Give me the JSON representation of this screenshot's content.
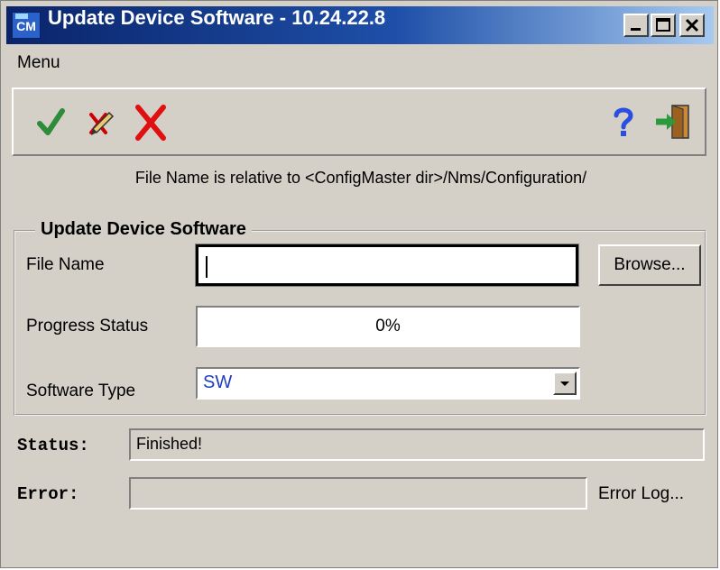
{
  "window": {
    "title": "Update Device Software - 10.24.22.8",
    "app_icon_text": "CM",
    "title_buttons": [
      "minimize-icon",
      "maximize-icon",
      "close-icon"
    ]
  },
  "menu": {
    "items": [
      "Menu"
    ]
  },
  "toolbar": {
    "tools": [
      {
        "name": "apply",
        "icon": "checkmark-icon",
        "color": "#2e8b3a"
      },
      {
        "name": "edit",
        "icon": "pencil-cross-icon",
        "color": "#cc0000"
      },
      {
        "name": "cancel",
        "icon": "red-x-icon",
        "color": "#e01010"
      },
      {
        "name": "help",
        "icon": "question-mark-icon",
        "color": "#2a4fe0"
      },
      {
        "name": "exit",
        "icon": "exit-door-icon",
        "color": "#2a9a3a"
      }
    ]
  },
  "hint_text": "File Name is relative to <ConfigMaster dir>/Nms/Configuration/",
  "update_group": {
    "legend": "Update Device Software",
    "file_name_label": "File Name",
    "file_name_value": "",
    "browse_label": "Browse...",
    "progress_label": "Progress Status",
    "progress_text": "0%",
    "progress_fraction": 0,
    "software_type_label": "Software Type",
    "software_type_value": "SW"
  },
  "status": {
    "label": "Status:",
    "value": "Finished!"
  },
  "error": {
    "label": "Error:",
    "value": "",
    "log_label": "Error Log..."
  }
}
